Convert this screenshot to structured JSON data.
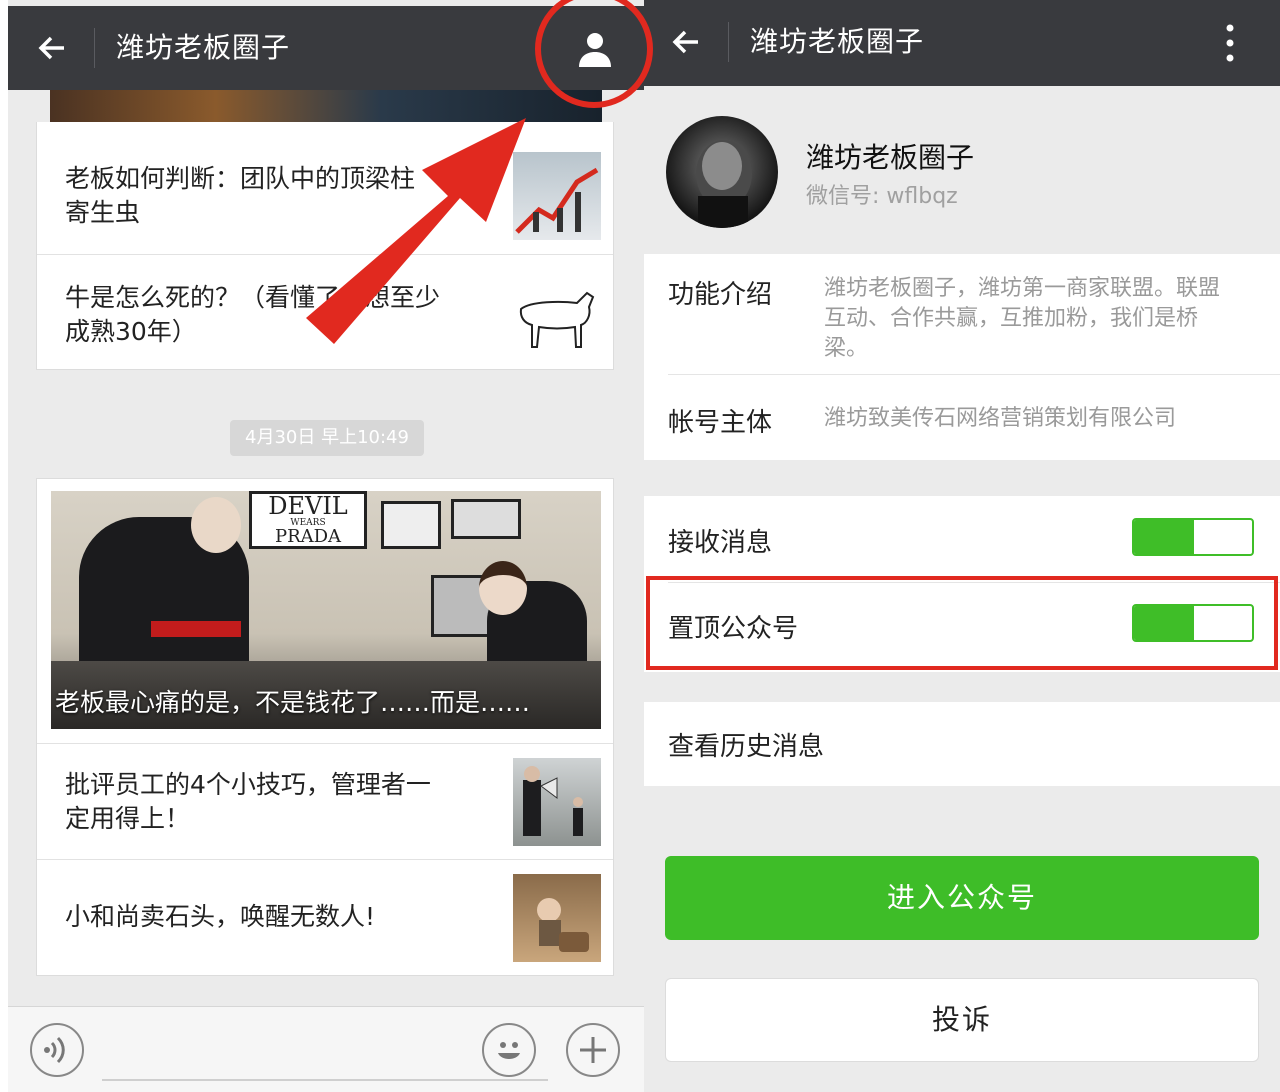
{
  "left": {
    "header": {
      "title": "潍坊老板圈子"
    },
    "articles_group1": [
      {
        "title": "老板如何判断：团队中的顶梁柱与寄生虫",
        "line1": "老板如何判断：团队中的顶梁柱",
        "line2": "寄生虫",
        "thumb_icon": "arrow-chart-figure"
      },
      {
        "title": "牛是怎么死的？（看懂了思想至少成熟30年）",
        "line1": "牛是怎么死的？（看懂了思想至少",
        "line2": "成熟30年）",
        "thumb_icon": "cow-sketch"
      }
    ],
    "timestamp": "4月30日 早上10:49",
    "cover": {
      "caption": "老板最心痛的是，不是钱花了……而是……",
      "poster_line1": "DEVIL",
      "poster_line2": "WEARS",
      "poster_line3": "PRADA"
    },
    "articles_group2": [
      {
        "line1": "批评员工的4个小技巧，管理者一",
        "line2": "定用得上！",
        "thumb_icon": "megaphone-boss"
      },
      {
        "line1": "小和尚卖石头，唤醒无数人!",
        "line2": "",
        "thumb_icon": "baby-with-stone"
      }
    ],
    "bottom": {
      "voice_icon": "voice-icon",
      "emoji_icon": "emoji-icon",
      "plus_icon": "plus-icon"
    }
  },
  "right": {
    "header": {
      "title": "潍坊老板圈子"
    },
    "profile": {
      "name": "潍坊老板圈子",
      "wechat_id": "微信号: wflbqz"
    },
    "intro": {
      "label": "功能介绍",
      "value_line1": "潍坊老板圈子，潍坊第一商家联盟。联盟",
      "value_line2": "互动、合作共赢，互推加粉，我们是桥",
      "value_line3": "梁。"
    },
    "owner": {
      "label": "帐号主体",
      "value": "潍坊致美传石网络营销策划有限公司"
    },
    "settings": [
      {
        "label": "接收消息",
        "on": true
      },
      {
        "label": "置顶公众号",
        "on": true
      }
    ],
    "history": {
      "label": "查看历史消息"
    },
    "enter_button": "进入公众号",
    "complain_button": "投诉"
  },
  "colors": {
    "accent_green": "#3ebd28",
    "header_bg": "#393a3e",
    "annotation_red": "#e1291f"
  }
}
